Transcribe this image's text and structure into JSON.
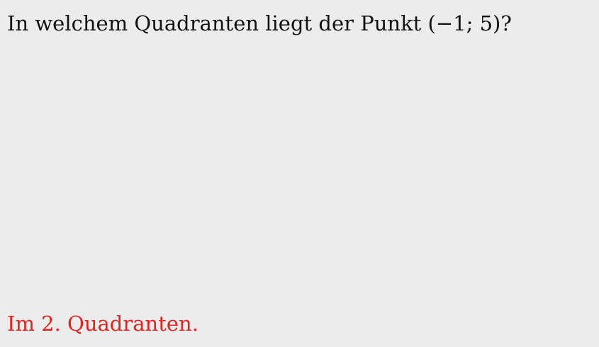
{
  "question": {
    "text": "In welchem Quadranten liegt der Punkt (−1; 5)?"
  },
  "answer": {
    "text": "Im 2. Quadranten.",
    "color": "#e8211c"
  }
}
